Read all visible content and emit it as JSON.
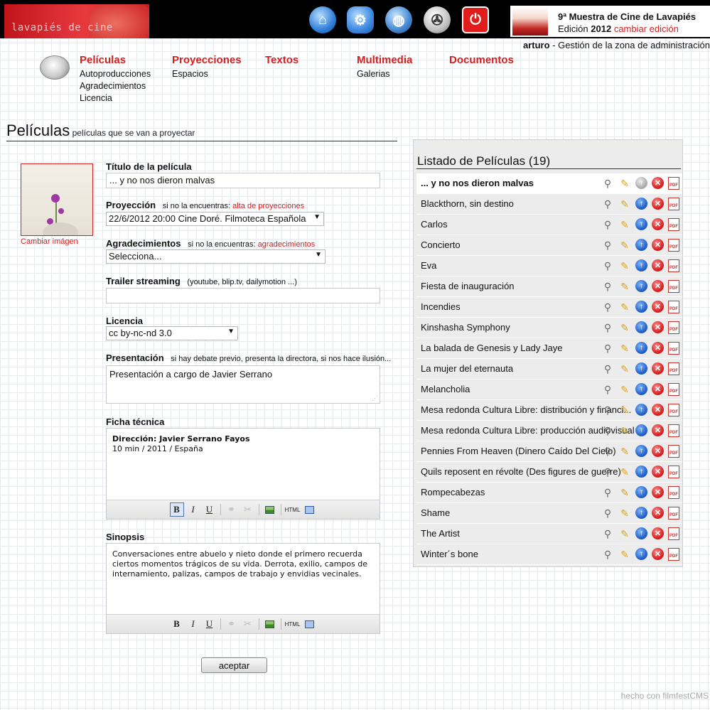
{
  "header": {
    "banner_text": "lavapiés de cine",
    "icons": [
      "home-icon",
      "gear-icon",
      "globe-icon",
      "film-reel-icon",
      "power-icon"
    ],
    "edition_title": "9ª Muestra de Cine de Lavapiés",
    "edition_prefix": "Edición",
    "edition_year": "2012",
    "change_edition": "cambiar edición",
    "user": "arturo",
    "user_suffix": "- Gestión de la zona de administración"
  },
  "menu": {
    "peliculas": {
      "title": "Películas",
      "items": [
        "Autoproducciones",
        "Agradecimientos",
        "Licencia"
      ]
    },
    "proyecciones": {
      "title": "Proyecciones",
      "items": [
        "Espacios"
      ]
    },
    "textos": {
      "title": "Textos"
    },
    "multimedia": {
      "title": "Multimedia",
      "items": [
        "Galerias"
      ]
    },
    "documentos": {
      "title": "Documentos"
    }
  },
  "section": {
    "title": "Películas",
    "subtitle": "películas que se van a proyectar"
  },
  "form": {
    "change_image": "Cambiar imágen",
    "title_label": "Título de la película",
    "title_value": "... y no nos dieron malvas",
    "projection_label": "Proyección",
    "projection_hint": "si no la encuentras:",
    "projection_link": "alta de proyecciones",
    "projection_value": "22/6/2012 20:00 Cine Doré. Filmoteca Española",
    "thanks_label": "Agradecimientos",
    "thanks_hint": "si no la encuentras:",
    "thanks_link": "agradecimientos",
    "thanks_value": "Selecciona...",
    "trailer_label": "Trailer streaming",
    "trailer_hint": "(youtube, blip.tv, dailymotion ...)",
    "trailer_value": "",
    "license_label": "Licencia",
    "license_value": "cc by-nc-nd 3.0",
    "presentation_label": "Presentación",
    "presentation_hint": "si hay debate previo, presenta la directora, si nos hace ilusión...",
    "presentation_value": "Presentación a cargo de Javier Serrano",
    "sheet_label": "Ficha técnica",
    "sheet_line1": "Dirección: Javier Serrano Fayos",
    "sheet_line2": "10 min / 2011 / España",
    "synopsis_label": "Sinopsis",
    "synopsis_value": "Conversaciones entre abuelo y nieto donde el primero recuerda ciertos momentos trágicos de su vida. Derrota, exilio, campos de internamiento, palizas, campos de trabajo y envidias vecinales.",
    "toolbar": {
      "bold": "B",
      "italic": "I",
      "underline": "U",
      "link": "⚭",
      "unlink": "✂",
      "html": "HTML"
    },
    "submit": "aceptar"
  },
  "list": {
    "title": "Listado de Películas (19)",
    "current_index": 0,
    "items": [
      "... y no nos dieron malvas",
      "Blackthorn, sin destino",
      "Carlos",
      "Concierto",
      "Eva",
      "Fiesta de inauguración",
      "Incendies",
      "Kinshasha Symphony",
      "La balada de Genesis y Lady Jaye",
      "La mujer del eternauta",
      "Melancholia",
      "Mesa redonda Cultura Libre: distribución y financi...",
      "Mesa redonda Cultura Libre: producción audiovisual",
      "Pennies From Heaven (Dinero Caído Del Cielo)",
      "Quils reposent en révolte (Des figures de guerre)",
      "Rompecabezas",
      "Shame",
      "The Artist",
      "Winter´s bone"
    ],
    "action_icons": [
      "magnifier-icon",
      "pencil-icon",
      "arrow-up-icon",
      "delete-icon",
      "pdf-icon"
    ],
    "pdf_label": "PDF"
  },
  "footer": "hecho con filmfestCMS"
}
